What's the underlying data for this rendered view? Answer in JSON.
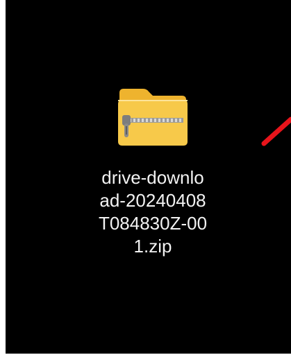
{
  "desktop": {
    "file": {
      "name_lines": [
        "drive-downlo",
        "ad-20240408",
        "T084830Z-00",
        "1.zip"
      ],
      "icon": "zip-folder-icon"
    }
  },
  "annotation": {
    "icon": "red-arrow-icon",
    "color": "#e8141b"
  },
  "colors": {
    "background": "#000000",
    "folder_front": "#f7c94a",
    "folder_back": "#eeb32e",
    "zipper": "#8a8a8a",
    "text": "#f2f2f2"
  }
}
